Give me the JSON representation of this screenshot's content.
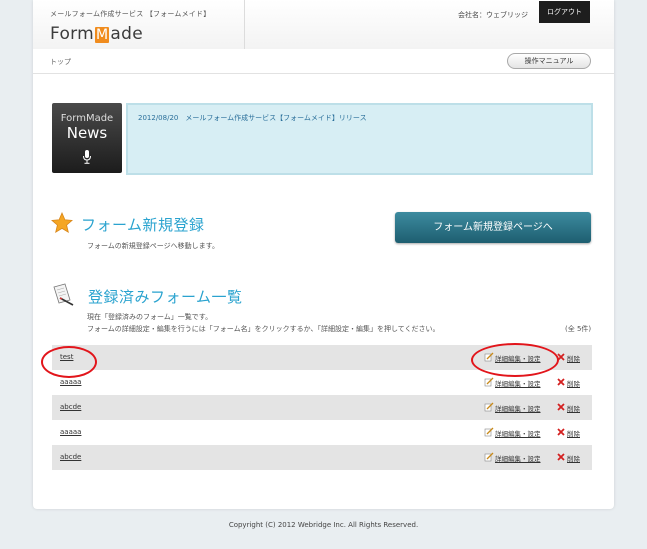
{
  "header": {
    "service_text": "メールフォーム作成サービス 【フォームメイド】",
    "logo_pre": "Form",
    "logo_m": "M",
    "logo_post": "ade",
    "company_label": "会社名：ウェブリッジ",
    "logout_label": "ログアウト"
  },
  "breadcrumb": {
    "top": "トップ",
    "manual_label": "操作マニュアル"
  },
  "news": {
    "badge_small": "FormMade",
    "badge_big": "News",
    "item": "2012/08/20　メールフォーム作成サービス【フォームメイド】リリース"
  },
  "new_form": {
    "title": "フォーム新規登録",
    "description": "フォームの新規登録ページへ移動します。",
    "button_label": "フォーム新規登録ページへ"
  },
  "registered": {
    "title": "登録済みフォーム一覧",
    "desc_line1": "現在「登録済みのフォーム」一覧です。",
    "desc_line2": "フォームの詳細設定・編集を行うには「フォーム名」をクリックするか、「詳細設定・編集」を押してください。",
    "total": "(全 5件)",
    "edit_label": "詳細編集・設定",
    "delete_label": "削除",
    "rows": [
      {
        "name": "test"
      },
      {
        "name": "aaaaa"
      },
      {
        "name": "abcde"
      },
      {
        "name": "aaaaa"
      },
      {
        "name": "abcde"
      }
    ]
  },
  "footer": {
    "copyright": "Copyright (C) 2012 Webridge Inc. All Rights Reserved."
  },
  "colors": {
    "accent_title": "#2aa3cf",
    "button_bg": "#24697c",
    "annotation": "#e2151b",
    "logo_m_bg": "#f08c1e"
  }
}
